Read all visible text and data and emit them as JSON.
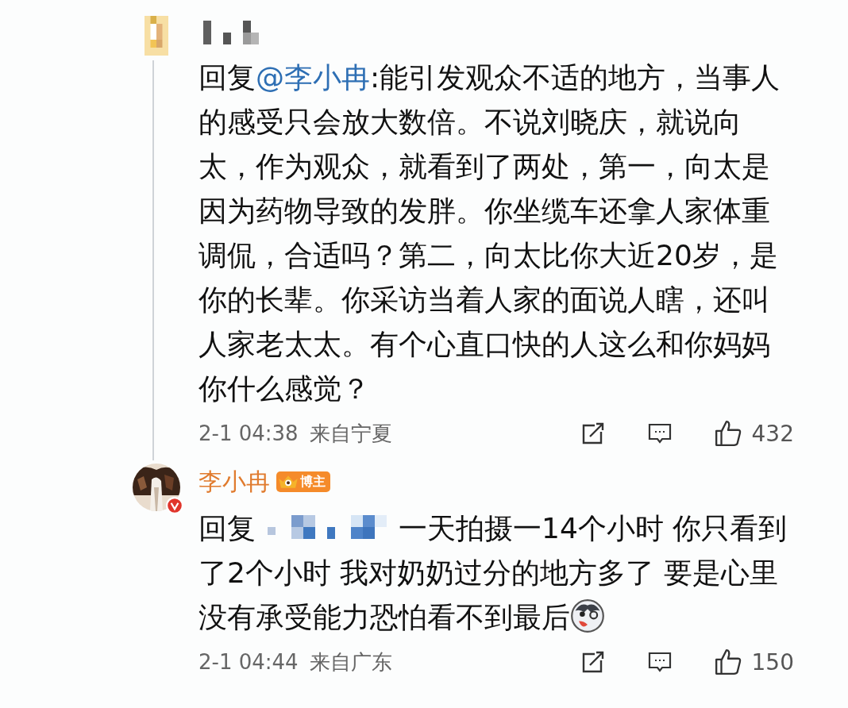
{
  "comments": [
    {
      "author_hidden": true,
      "reply_prefix": "回复",
      "mention": "@李小冉",
      "text": ":能引发观众不适的地方，当事人的感受只会放大数倍。不说刘晓庆，就说向太，作为观众，就看到了两处，第一，向太是因为药物导致的发胖。你坐缆车还拿人家体重调侃，合适吗？第二，向太比你大近20岁，是你的长辈。你采访当着人家的面说人瞎，还叫人家老太太。有个心直口快的人这么和你妈妈你什么感觉？",
      "time": "2-1 04:38",
      "location": "来自宁夏",
      "likes": "432"
    },
    {
      "author": "李小冉",
      "badge": "博主",
      "verified": true,
      "reply_prefix": "回复",
      "mention_hidden": true,
      "text": "一天拍摄一14个小时 你只看到了2个小时 我对奶奶过分的地方多了 要是心里没有承受能力恐怕看不到最后",
      "emoji": true,
      "time": "2-1 04:44",
      "location": "来自广东",
      "likes": "150"
    }
  ]
}
